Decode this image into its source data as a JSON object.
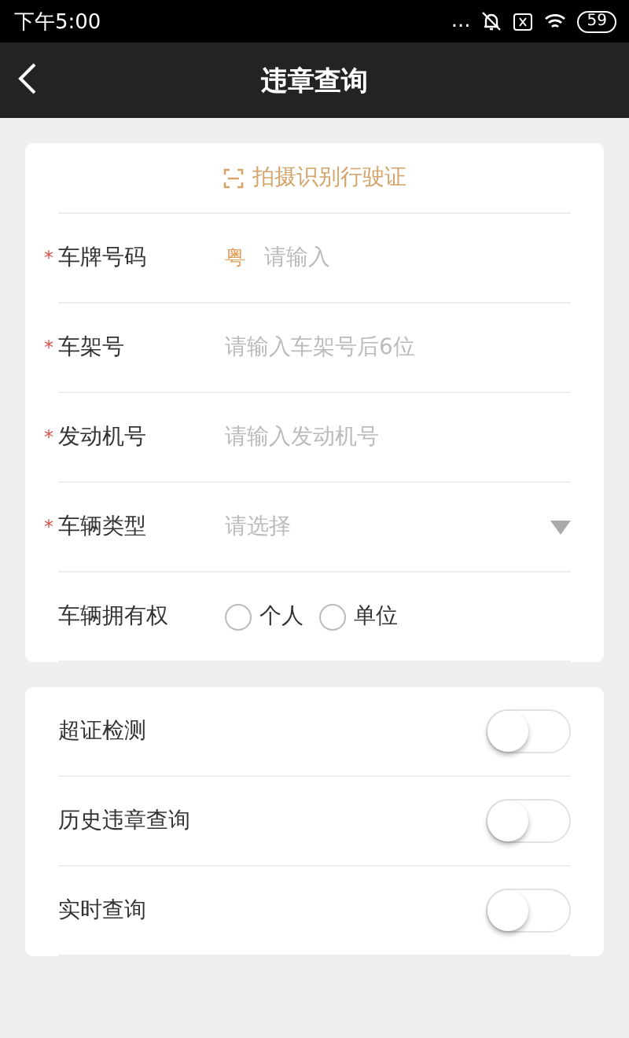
{
  "status_bar": {
    "time": "下午5:00",
    "dots": "...",
    "battery": "59"
  },
  "nav": {
    "title": "违章查询"
  },
  "scan": {
    "label": "拍摄识别行驶证"
  },
  "fields": [
    {
      "kind": "text",
      "label": "车牌号码",
      "required_mark": "*",
      "prefix": "粤",
      "placeholder": "请输入"
    },
    {
      "kind": "text",
      "label": "车架号",
      "required_mark": "*",
      "placeholder": "请输入车架号后6位"
    },
    {
      "kind": "text",
      "label": "发动机号",
      "required_mark": "*",
      "placeholder": "请输入发动机号"
    },
    {
      "kind": "select",
      "label": "车辆类型",
      "required_mark": "*",
      "placeholder": "请选择"
    },
    {
      "kind": "radio",
      "label": "车辆拥有权",
      "options": [
        {
          "label": "个人",
          "selected": false
        },
        {
          "label": "单位",
          "selected": false
        }
      ]
    }
  ],
  "toggles": [
    {
      "label": "超证检测",
      "on": false
    },
    {
      "label": "历史违章查询",
      "on": false
    },
    {
      "label": "实时查询",
      "on": false
    }
  ]
}
